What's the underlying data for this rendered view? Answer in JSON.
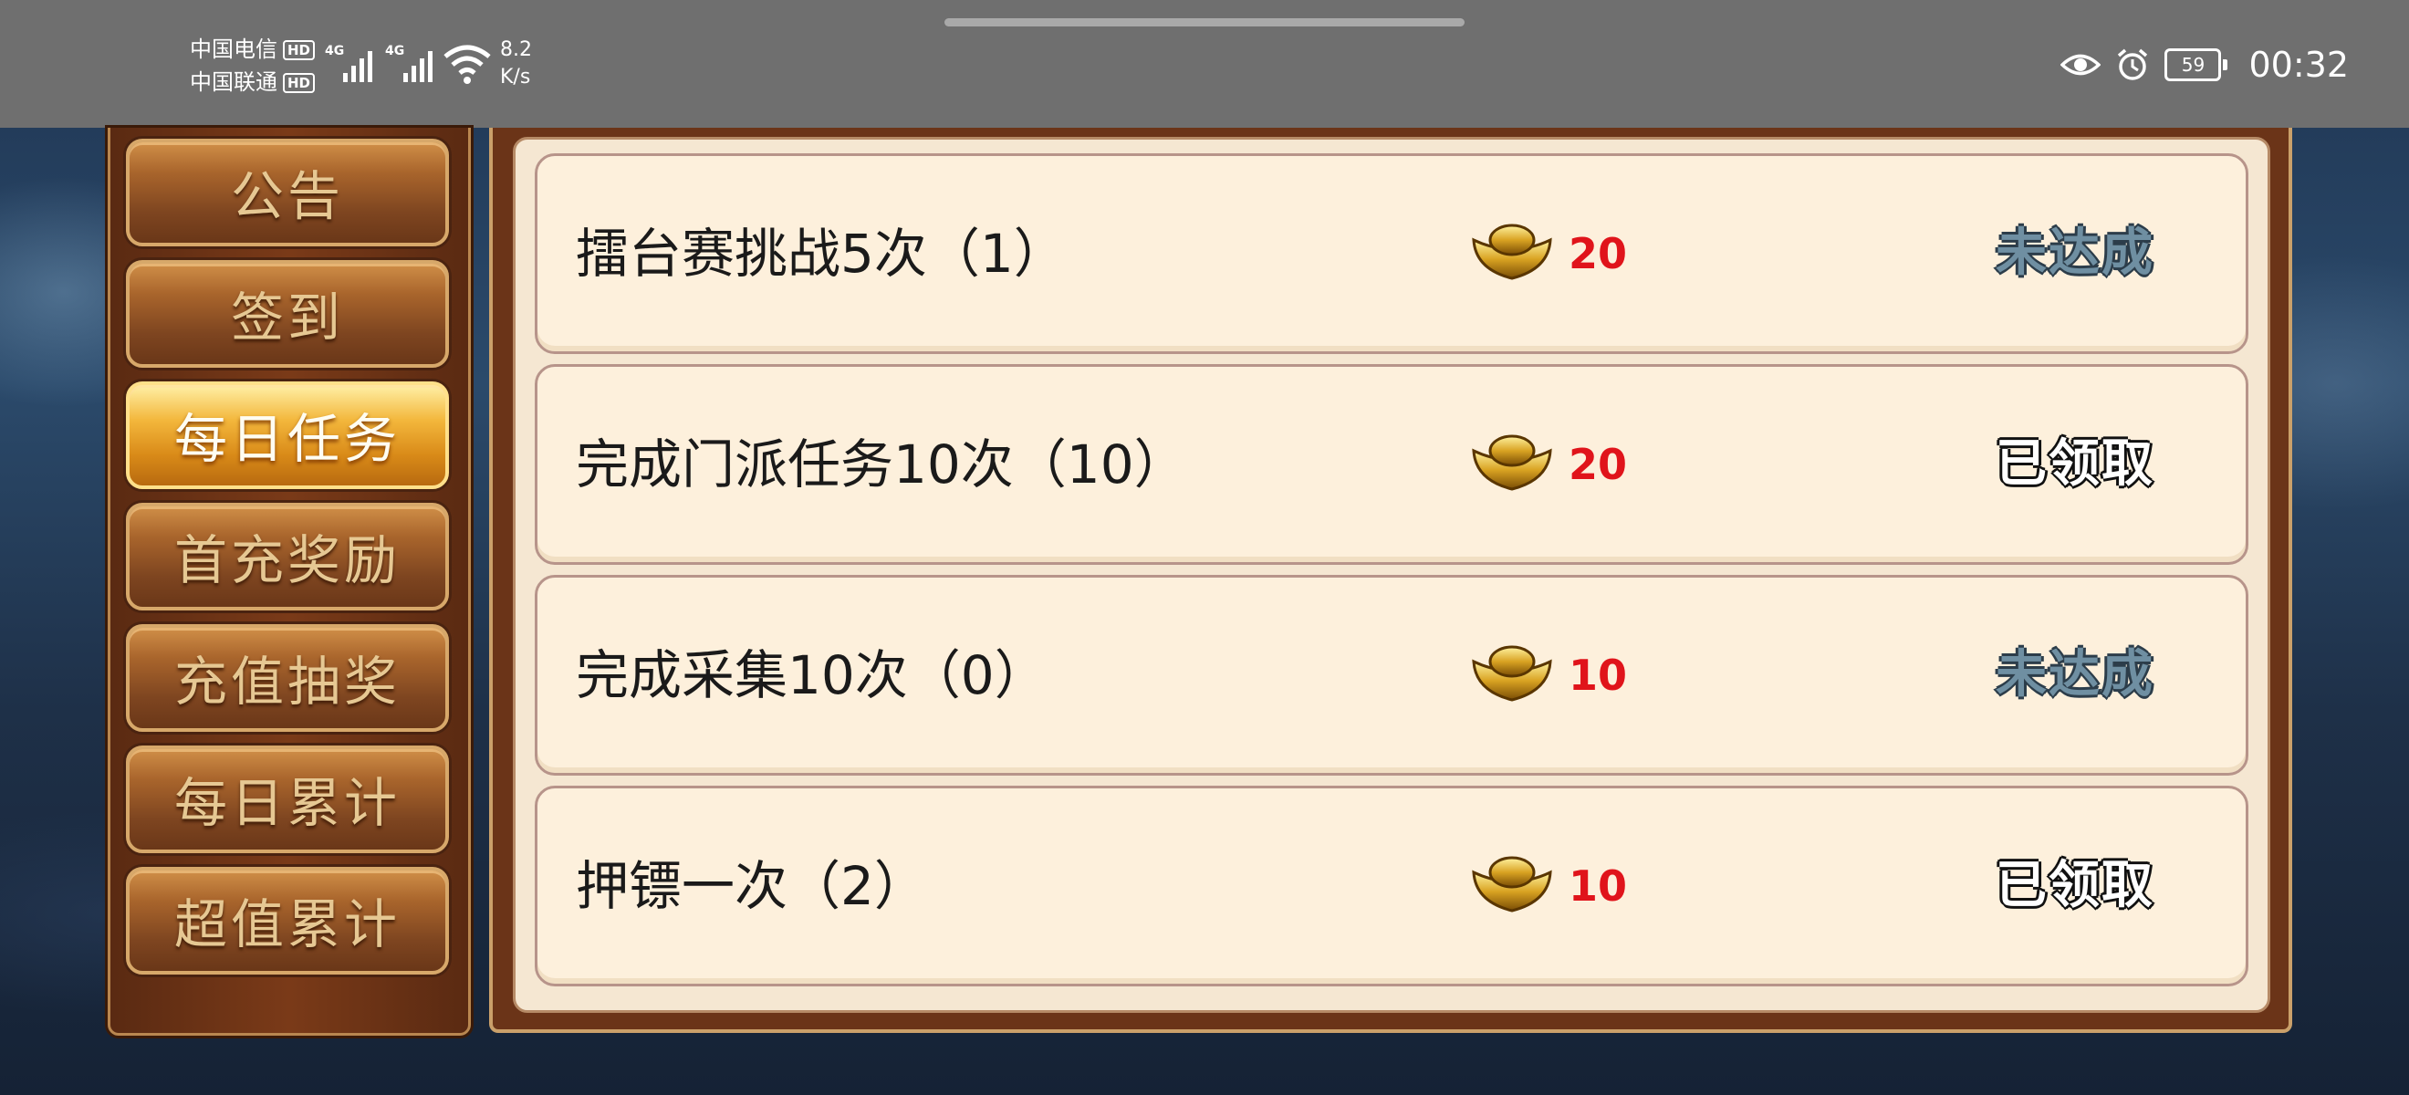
{
  "status_bar": {
    "carrier_1": "中国电信",
    "carrier_2": "中国联通",
    "hd_badge": "HD",
    "network_1": "4G",
    "network_2": "4G",
    "speed_value": "8.2",
    "speed_unit": "K/s",
    "battery": "59",
    "time": "00:32",
    "icons": [
      "signal-icon",
      "wifi-icon",
      "eye-icon",
      "alarm-icon",
      "battery-icon"
    ]
  },
  "menu": {
    "items": [
      {
        "label": "公告"
      },
      {
        "label": "签到"
      },
      {
        "label": "每日任务"
      },
      {
        "label": "首充奖励"
      },
      {
        "label": "充值抽奖"
      },
      {
        "label": "每日累计"
      },
      {
        "label": "超值累计"
      }
    ],
    "active_item": "每日任务"
  },
  "tasks": [
    {
      "name": "擂台赛挑战5次（1）",
      "reward": "20",
      "status": "未达成"
    },
    {
      "name": "完成门派任务10次（10）",
      "reward": "20",
      "status": "已领取"
    },
    {
      "name": "完成采集10次（0）",
      "reward": "10",
      "status": "未达成"
    },
    {
      "name": "押镖一次（2）",
      "reward": "10",
      "status": "已领取"
    }
  ],
  "colors": {
    "reward_red": "#e0141b",
    "unmet_blue": "#6f8fa2",
    "panel_brown": "#6b3418",
    "row_cream": "#fdf0dc",
    "active_gold": "#f3b73c"
  }
}
